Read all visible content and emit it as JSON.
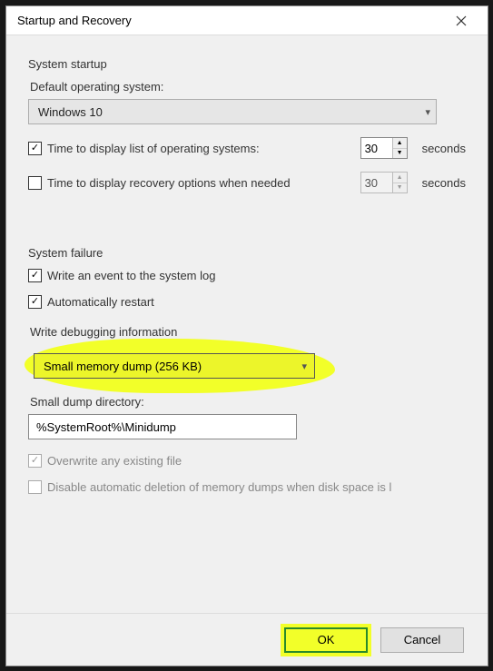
{
  "window": {
    "title": "Startup and Recovery"
  },
  "startup": {
    "section_label": "System startup",
    "default_os_label": "Default operating system:",
    "default_os_value": "Windows 10",
    "display_os_list": {
      "checked": true,
      "label": "Time to display list of operating systems:",
      "value": "30",
      "unit": "seconds"
    },
    "display_recovery": {
      "checked": false,
      "label": "Time to display recovery options when needed",
      "value": "30",
      "unit": "seconds"
    }
  },
  "failure": {
    "section_label": "System failure",
    "write_log": {
      "checked": true,
      "label": "Write an event to the system log"
    },
    "auto_restart": {
      "checked": true,
      "label": "Automatically restart"
    },
    "debug_label": "Write debugging information",
    "debug_select_value": "Small memory dump (256 KB)",
    "dump_dir_label": "Small dump directory:",
    "dump_dir_value": "%SystemRoot%\\Minidump",
    "overwrite": {
      "checked": true,
      "label": "Overwrite any existing file",
      "disabled": true
    },
    "disable_delete": {
      "checked": false,
      "label": "Disable automatic deletion of memory dumps when disk space is l",
      "disabled": true
    }
  },
  "buttons": {
    "ok": "OK",
    "cancel": "Cancel"
  }
}
